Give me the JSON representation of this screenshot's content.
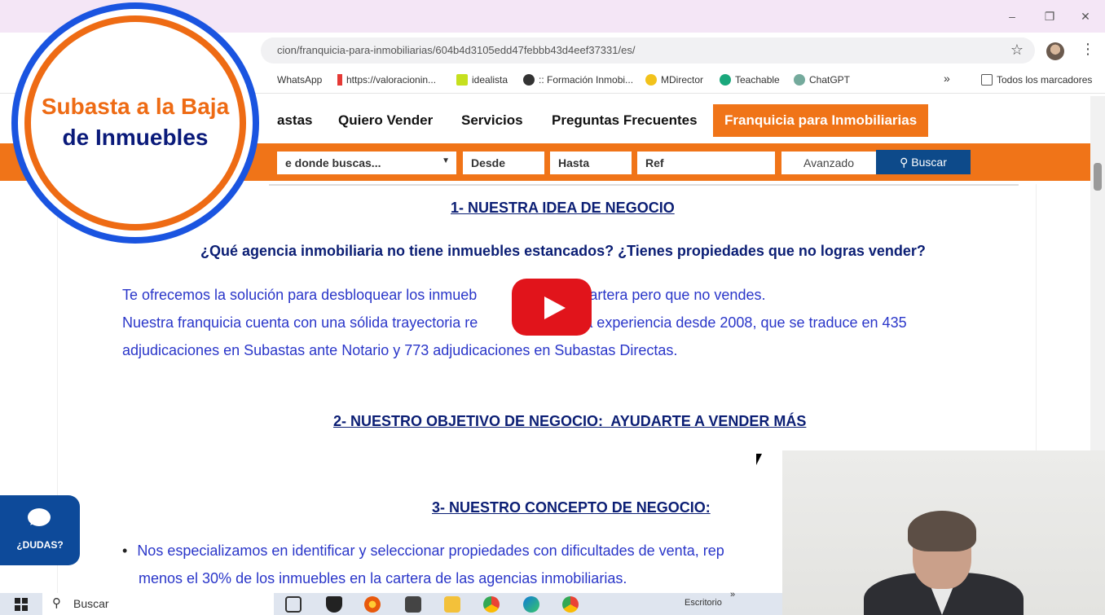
{
  "browser": {
    "url": "cion/franquicia-para-inmobiliarias/604b4d3105edd47febbb43d4eef37331/es/",
    "window_controls": {
      "minimize": "–",
      "maximize": "❐",
      "close": "✕"
    },
    "bookmarks": [
      {
        "label": "WhatsApp",
        "color": "#ffffff"
      },
      {
        "label": "https://valoracionin...",
        "color": "#e53935"
      },
      {
        "label": "idealista",
        "color": "#c6e01e"
      },
      {
        "label": ":: Formación Inmobi...",
        "color": "#333333"
      },
      {
        "label": "MDirector",
        "color": "#f2c21b"
      },
      {
        "label": "Teachable",
        "color": "#1aa87c"
      },
      {
        "label": "ChatGPT",
        "color": "#74aa9c"
      }
    ],
    "bookmarks_more": "»",
    "all_bookmarks": "Todos los marcadores"
  },
  "site": {
    "nav": [
      {
        "label": "astas"
      },
      {
        "label": "Quiero Vender"
      },
      {
        "label": "Servicios"
      },
      {
        "label": "Preguntas Frecuentes"
      },
      {
        "label": "Franquicia para Inmobiliarias"
      }
    ],
    "search": {
      "location": "e donde buscas...",
      "from": "Desde",
      "to": "Hasta",
      "ref": "Ref",
      "advanced": "Avanzado",
      "submit": "Buscar"
    }
  },
  "logo": {
    "line1": "Subasta a la Baja",
    "line2": "de Inmuebles"
  },
  "content": {
    "section1_title": "1- NUESTRA IDEA DE NEGOCIO",
    "question": "¿Qué agencia inmobiliaria no tiene inmuebles estancados? ¿Tienes propiedades que no logras vender?",
    "para1": "Te ofrecemos la solución para desbloquear los inmueb          nes en tu cartera pero que no vendes.",
    "para2": "Nuestra franquicia cuenta con una sólida trayectoria re            or nuestra experiencia desde 2008, que se traduce en 435",
    "para3": "adjudicaciones en Subastas ante Notario y 773 adjudicaciones en Subastas Directas.",
    "section2_title": "2- NUESTRO OBJETIVO DE NEGOCIO:  AYUDARTE A VENDER MÁS",
    "section3_title": "3- NUESTRO CONCEPTO DE NEGOCIO:",
    "bullet1": "Nos especializamos en identificar y seleccionar propiedades con dificultades de venta, rep",
    "bullet1_cont": "menos el 30% de los inmuebles en la cartera de las agencias inmobiliarias."
  },
  "chat": {
    "label": "¿DUDAS?"
  },
  "taskbar": {
    "search": "Buscar",
    "desktop": "Escritorio",
    "desktop_more": "»"
  }
}
